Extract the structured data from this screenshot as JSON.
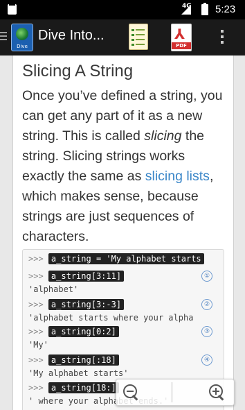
{
  "status_bar": {
    "network": "4G",
    "time": "5:23"
  },
  "action_bar": {
    "title": "Dive Into...",
    "app_icon_label": "Dive",
    "pdf_label": "PDF",
    "icons": [
      "menu-icon",
      "app-icon",
      "toc-icon",
      "pdf-icon",
      "overflow-menu-icon"
    ]
  },
  "article": {
    "heading": "Slicing A String",
    "para_1": "Once you’ve defined a string, you can get any part of it as a new string. This is called ",
    "para_em": "slicing",
    "para_2": " the string. Slicing strings works exactly the same as ",
    "link_text": "slicing lists",
    "para_3": ", which makes sense, because strings are just sequences of characters."
  },
  "code": {
    "prompt": ">>>",
    "lines": [
      {
        "cmd": "a_string = 'My alphabet starts"
      },
      {
        "cmd": "a_string[3:11]",
        "marker": "①",
        "out": "'alphabet'"
      },
      {
        "cmd": "a_string[3:-3]",
        "marker": "②",
        "out": "'alphabet starts where your alpha"
      },
      {
        "cmd": "a_string[0:2]",
        "marker": "③",
        "out": "'My'"
      },
      {
        "cmd": "a_string[:18]",
        "marker": "④",
        "out": "'My alphabet starts'"
      },
      {
        "cmd": "a_string[18:]",
        "out": "' where your alphabet ends.'"
      }
    ]
  },
  "zoom": {
    "out": "zoom-out-icon",
    "in": "zoom-in-icon"
  }
}
